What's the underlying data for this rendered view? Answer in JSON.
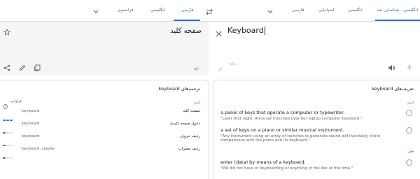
{
  "source_languages": {
    "tabs": [
      "انگلیسی - شناسایی شد",
      "انگلیسی",
      "اسپانیایی",
      "فارسی"
    ],
    "active_index": 0
  },
  "target_languages": {
    "tabs": [
      "فارسی",
      "انگلیسی",
      "فرانسوی"
    ],
    "active_index": 0
  },
  "input": {
    "text": "Keyboard",
    "char_count": "۸/۵۰۰۰"
  },
  "output": {
    "text": "صفحه کلید"
  },
  "translations_card": {
    "title": "ترجمه‌های keyboard",
    "pos": "اسم",
    "frequency_label": "فراوانی",
    "rows": [
      {
        "term": "صفحه کلید",
        "translations": "keyboard",
        "frequency": 3
      },
      {
        "term": "دخول صفحه کلیدی",
        "translations": "keyboard",
        "frequency": 1
      },
      {
        "term": "ردیف حروف",
        "translations": "keyboard",
        "frequency": 1
      },
      {
        "term": "ردیف مضراب",
        "translations": "keyboard, clavier",
        "frequency": 1
      }
    ]
  },
  "definitions_card": {
    "title": "تعریف‌های keyboard",
    "pos_noun": "اسم",
    "pos_verb": "فعل",
    "definitions": [
      {
        "text": "a panel of keys that operate a computer or typewriter.",
        "example": "\"Later that night, Anna sat hunched over her laptop computer keyboard.\""
      },
      {
        "text": "a set of keys on a piano or similar musical instrument.",
        "example": "\"Any instrument using an array of switches to generate sound will inevitably invite comparisons with the piano and its keyboard.\""
      },
      {
        "text": "enter (data) by means of a keyboard.",
        "example": "\"We did not have or keyboarding or anything of the like at the time.\""
      }
    ]
  },
  "colors": {
    "accent": "#1a73e8",
    "bar_empty": "#dadce0",
    "panel_bg": "#f5f5f5"
  }
}
